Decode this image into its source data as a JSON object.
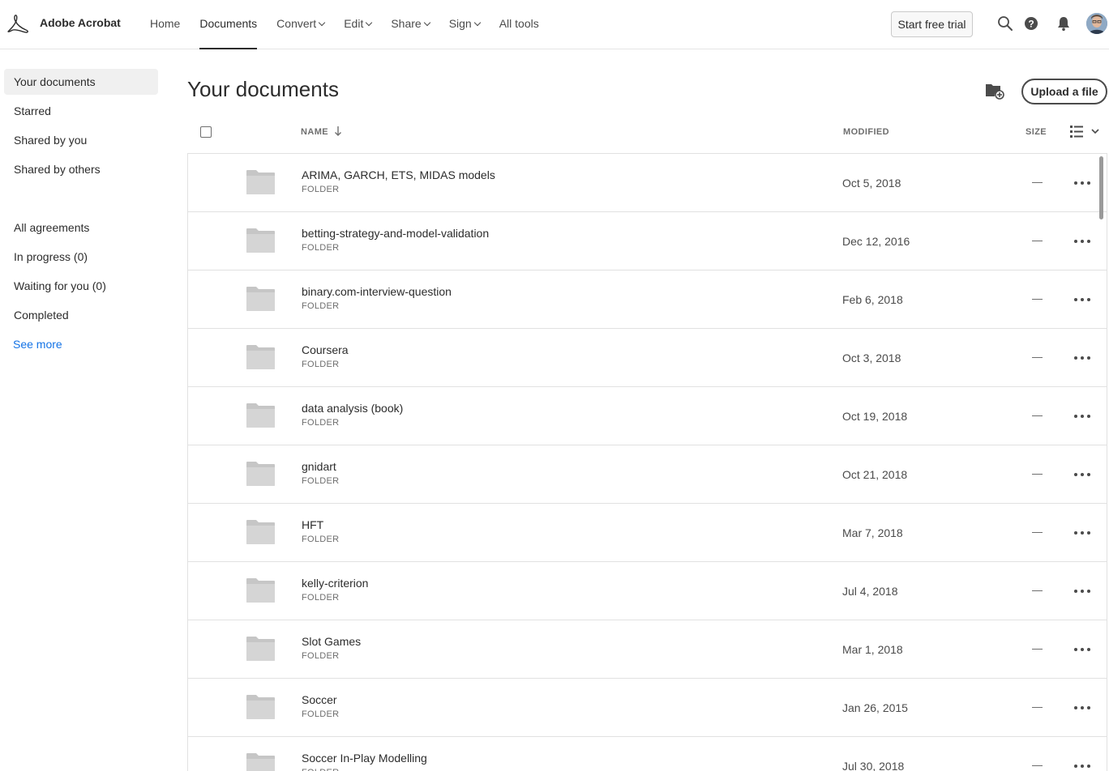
{
  "app": {
    "name": "Adobe Acrobat"
  },
  "nav": {
    "items": [
      {
        "label": "Home",
        "has_menu": false,
        "active": false
      },
      {
        "label": "Documents",
        "has_menu": false,
        "active": true
      },
      {
        "label": "Convert",
        "has_menu": true,
        "active": false
      },
      {
        "label": "Edit",
        "has_menu": true,
        "active": false
      },
      {
        "label": "Share",
        "has_menu": true,
        "active": false
      },
      {
        "label": "Sign",
        "has_menu": true,
        "active": false
      },
      {
        "label": "All tools",
        "has_menu": false,
        "active": false
      }
    ],
    "trial_button": "Start free trial",
    "icons": [
      "search-icon",
      "help-icon",
      "notifications-icon",
      "avatar"
    ]
  },
  "sidebar": {
    "items": [
      {
        "label": "Your documents",
        "active": true
      },
      {
        "label": "Starred"
      },
      {
        "label": "Shared by you"
      },
      {
        "label": "Shared by others"
      },
      {
        "label": "All agreements"
      },
      {
        "label": "In progress (0)"
      },
      {
        "label": "Waiting for you (0)"
      },
      {
        "label": "Completed"
      },
      {
        "label": "See more",
        "link": true
      }
    ]
  },
  "main": {
    "title": "Your documents",
    "upload_button": "Upload a file",
    "columns": {
      "name": "NAME",
      "modified": "MODIFIED",
      "size": "SIZE"
    },
    "sort": {
      "column": "NAME",
      "direction": "ascending"
    },
    "rows": [
      {
        "name": "ARIMA, GARCH, ETS, MIDAS models",
        "type": "FOLDER",
        "modified": "Oct 5, 2018",
        "size": "—"
      },
      {
        "name": "betting-strategy-and-model-validation",
        "type": "FOLDER",
        "modified": "Dec 12, 2016",
        "size": "—"
      },
      {
        "name": "binary.com-interview-question",
        "type": "FOLDER",
        "modified": "Feb 6, 2018",
        "size": "—"
      },
      {
        "name": "Coursera",
        "type": "FOLDER",
        "modified": "Oct 3, 2018",
        "size": "—"
      },
      {
        "name": "data analysis (book)",
        "type": "FOLDER",
        "modified": "Oct 19, 2018",
        "size": "—"
      },
      {
        "name": "gnidart",
        "type": "FOLDER",
        "modified": "Oct 21, 2018",
        "size": "—"
      },
      {
        "name": "HFT",
        "type": "FOLDER",
        "modified": "Mar 7, 2018",
        "size": "—"
      },
      {
        "name": "kelly-criterion",
        "type": "FOLDER",
        "modified": "Jul 4, 2018",
        "size": "—"
      },
      {
        "name": "Slot Games",
        "type": "FOLDER",
        "modified": "Mar 1, 2018",
        "size": "—"
      },
      {
        "name": "Soccer",
        "type": "FOLDER",
        "modified": "Jan 26, 2015",
        "size": "—"
      },
      {
        "name": "Soccer In-Play Modelling",
        "type": "FOLDER",
        "modified": "Jul 30, 2018",
        "size": "—"
      }
    ]
  },
  "colors": {
    "accent": "#1473e6",
    "text": "#2c2c2c",
    "muted": "#6e6e6e",
    "folder": "#c6c6c6",
    "border": "#e1e1e1"
  }
}
